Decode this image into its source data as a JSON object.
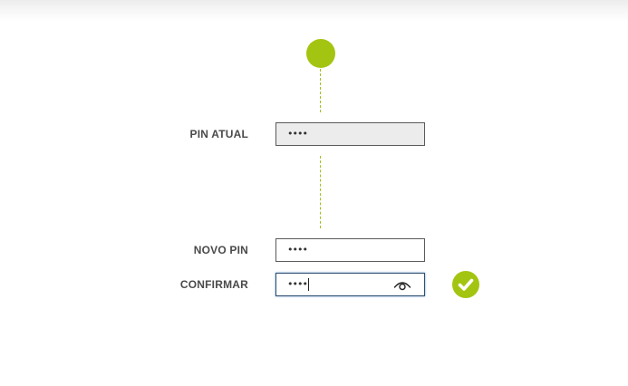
{
  "form": {
    "current_pin": {
      "label": "PIN ATUAL",
      "value": "••••"
    },
    "new_pin": {
      "label": "NOVO PIN",
      "value": "••••"
    },
    "confirm_pin": {
      "label": "CONFIRMAR",
      "value": "••••"
    }
  },
  "icons": {
    "step": "step-dot-icon",
    "reveal": "eye-icon",
    "valid": "checkmark-icon"
  },
  "colors": {
    "accent": "#a3c511",
    "connector": "#9ec21a",
    "label": "#4a4a4a",
    "disabled_field": "#ececec"
  }
}
